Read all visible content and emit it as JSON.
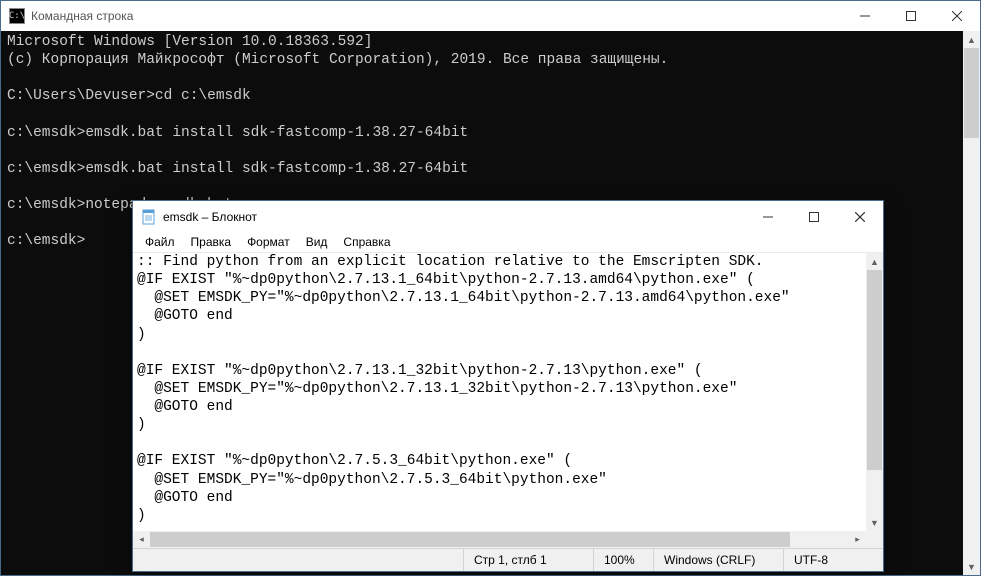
{
  "cmd": {
    "title": "Командная строка",
    "icon_label": "C:\\",
    "lines": [
      "Microsoft Windows [Version 10.0.18363.592]",
      "(c) Корпорация Майкрософт (Microsoft Corporation), 2019. Все права защищены.",
      "",
      "C:\\Users\\Devuser>cd c:\\emsdk",
      "",
      "c:\\emsdk>emsdk.bat install sdk-fastcomp-1.38.27-64bit",
      "",
      "c:\\emsdk>emsdk.bat install sdk-fastcomp-1.38.27-64bit",
      "",
      "c:\\emsdk>notepad emsdk.bat",
      "",
      "c:\\emsdk>"
    ]
  },
  "notepad": {
    "title": "emsdk – Блокнот",
    "menu": {
      "file": "Файл",
      "edit": "Правка",
      "format": "Формат",
      "view": "Вид",
      "help": "Справка"
    },
    "content": [
      ":: Find python from an explicit location relative to the Emscripten SDK.",
      "@IF EXIST \"%~dp0python\\2.7.13.1_64bit\\python-2.7.13.amd64\\python.exe\" (",
      "  @SET EMSDK_PY=\"%~dp0python\\2.7.13.1_64bit\\python-2.7.13.amd64\\python.exe\"",
      "  @GOTO end",
      ")",
      "",
      "@IF EXIST \"%~dp0python\\2.7.13.1_32bit\\python-2.7.13\\python.exe\" (",
      "  @SET EMSDK_PY=\"%~dp0python\\2.7.13.1_32bit\\python-2.7.13\\python.exe\"",
      "  @GOTO end",
      ")",
      "",
      "@IF EXIST \"%~dp0python\\2.7.5.3_64bit\\python.exe\" (",
      "  @SET EMSDK_PY=\"%~dp0python\\2.7.5.3_64bit\\python.exe\"",
      "  @GOTO end",
      ")"
    ],
    "status": {
      "position": "Стр 1, стлб 1",
      "zoom": "100%",
      "line_ending": "Windows (CRLF)",
      "encoding": "UTF-8"
    }
  }
}
